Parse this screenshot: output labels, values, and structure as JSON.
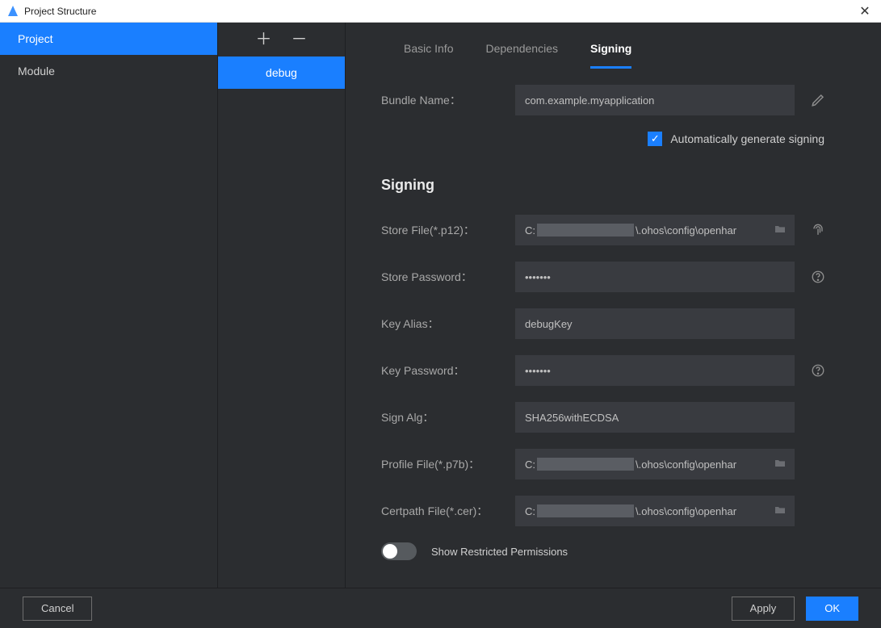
{
  "window": {
    "title": "Project Structure"
  },
  "sidebar": {
    "items": [
      {
        "label": "Project",
        "active": true
      },
      {
        "label": "Module",
        "active": false
      }
    ]
  },
  "configs": {
    "items": [
      {
        "label": "debug",
        "active": true
      }
    ]
  },
  "tabs": [
    {
      "label": "Basic Info",
      "active": false
    },
    {
      "label": "Dependencies",
      "active": false
    },
    {
      "label": "Signing",
      "active": true
    }
  ],
  "form": {
    "bundle_name_label": "Bundle Name：",
    "bundle_name_value": "com.example.myapplication",
    "auto_sign_label": "Automatically generate signing",
    "auto_sign_checked": true,
    "section_title": "Signing",
    "store_file_label": "Store File(*.p12)：",
    "store_file_prefix": "C:",
    "store_file_suffix": "\\.ohos\\config\\openhar",
    "store_password_label": "Store Password：",
    "store_password_value": "•••••••",
    "key_alias_label": "Key Alias：",
    "key_alias_value": "debugKey",
    "key_password_label": "Key Password：",
    "key_password_value": "•••••••",
    "sign_alg_label": "Sign Alg：",
    "sign_alg_value": "SHA256withECDSA",
    "profile_file_label": "Profile File(*.p7b)：",
    "profile_file_prefix": "C:",
    "profile_file_suffix": "\\.ohos\\config\\openhar",
    "certpath_file_label": "Certpath File(*.cer)：",
    "certpath_file_prefix": "C:",
    "certpath_file_suffix": "\\.ohos\\config\\openhar",
    "restricted_label": "Show Restricted Permissions"
  },
  "footer": {
    "cancel": "Cancel",
    "apply": "Apply",
    "ok": "OK"
  }
}
